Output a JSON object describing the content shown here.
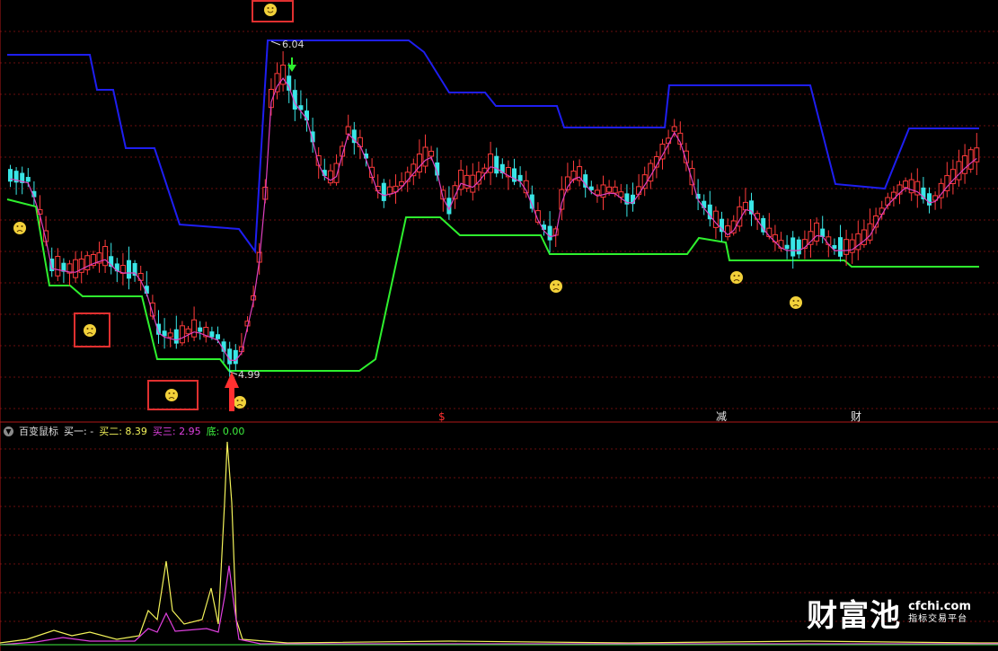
{
  "colors": {
    "background": "#000000",
    "grid": "#7a1010",
    "divider": "#b01818",
    "candle_up": "#ff3b3b",
    "candle_down": "#39e6e6",
    "upper_band": "#1e1ef0",
    "lower_band": "#2ef02e",
    "ma_line": "#e040c0",
    "line_buy1": "#f3f35a",
    "line_buy2": "#e040e0",
    "line_bottom": "#3ef03e",
    "highlight_box": "#e03030",
    "arrow": "#ff3030"
  },
  "price_chart": {
    "high_label": "6.04",
    "low_label": "4.99",
    "event_markers": [
      {
        "label": "$",
        "color": "#ff3030"
      },
      {
        "label": "减",
        "color": "#e8e8e8"
      },
      {
        "label": "财",
        "color": "#e8e8e8"
      }
    ],
    "icons": {
      "frown": "frown-face-icon",
      "smile": "smile-face-icon",
      "buy_arrow": "up-arrow-icon",
      "down_signal": "green-down-arrow-icon"
    }
  },
  "indicator": {
    "name": "百变鼠标",
    "buy1_label": "买一:",
    "buy1_value": "-",
    "buy2_label": "买二:",
    "buy2_value": "8.39",
    "buy3_label": "买三:",
    "buy3_value": "2.95",
    "bottom_label": "底:",
    "bottom_value": "0.00"
  },
  "watermark": {
    "brand": "财富池",
    "site": "cfchi.com",
    "tagline": "指标交易平台"
  }
}
